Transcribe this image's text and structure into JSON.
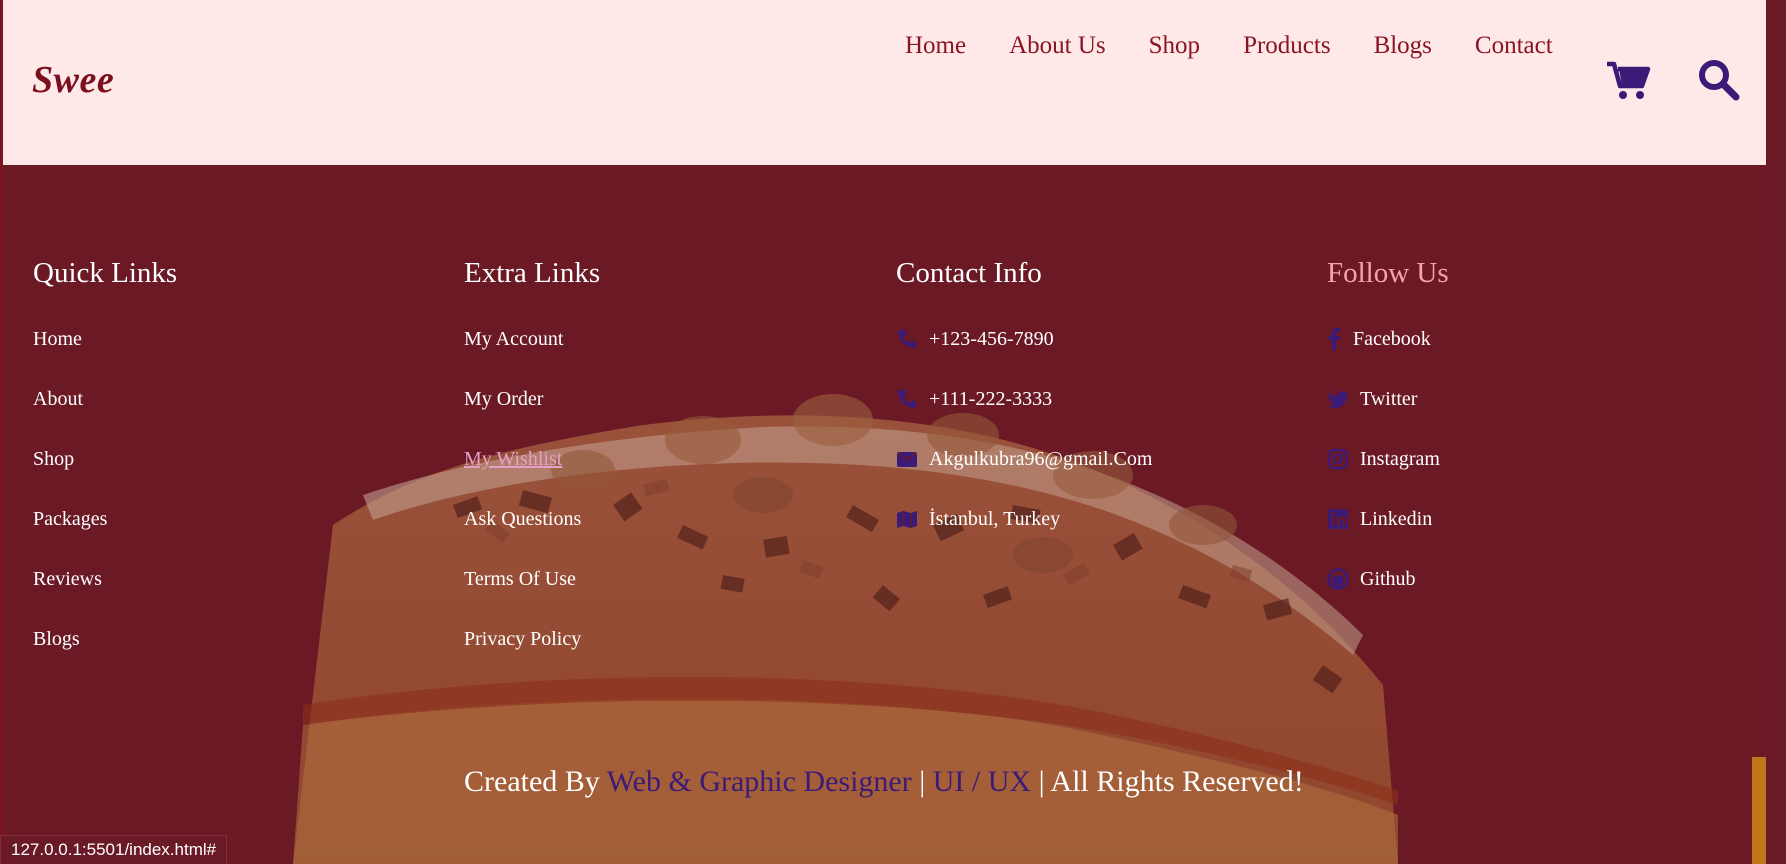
{
  "header": {
    "logo": "Swee",
    "nav": [
      "Home",
      "About Us",
      "Shop",
      "Products",
      "Blogs",
      "Contact"
    ]
  },
  "icons": {
    "cart": "cart-icon",
    "search": "search-icon"
  },
  "footer": {
    "quick_links": {
      "title": "Quick Links",
      "items": [
        "Home",
        "About",
        "Shop",
        "Packages",
        "Reviews",
        "Blogs"
      ]
    },
    "extra_links": {
      "title": "Extra Links",
      "items": [
        "My Account",
        "My Order",
        "My Wishlist",
        "Ask Questions",
        "Terms Of Use",
        "Privacy Policy"
      ]
    },
    "contact_info": {
      "title": "Contact Info",
      "items": [
        {
          "icon": "phone-icon",
          "text": "+123-456-7890"
        },
        {
          "icon": "phone-icon",
          "text": "+111-222-3333"
        },
        {
          "icon": "envelope-icon",
          "text": "Akgulkubra96@gmail.Com"
        },
        {
          "icon": "map-icon",
          "text": "İstanbul, Turkey"
        }
      ]
    },
    "follow_us": {
      "title": "Follow Us",
      "items": [
        {
          "icon": "facebook-icon",
          "text": "Facebook"
        },
        {
          "icon": "twitter-icon",
          "text": "Twitter"
        },
        {
          "icon": "instagram-icon",
          "text": "Instagram"
        },
        {
          "icon": "linkedin-icon",
          "text": "Linkedin"
        },
        {
          "icon": "github-icon",
          "text": "Github"
        }
      ]
    },
    "credit": {
      "prefix": "Created By ",
      "designer": "Web & Graphic Designer",
      "sep1": " | ",
      "uiux": "UI / UX",
      "suffix": " | All Rights Reserved!"
    }
  },
  "status_bar": "127.0.0.1:5501/index.html#",
  "colors": {
    "header_bg": "#ffe8e8",
    "footer_bg": "#6a1a26",
    "brand": "#7a0f1d",
    "icon_accent": "#3b1a78",
    "follow_title": "#f5a5a8"
  }
}
